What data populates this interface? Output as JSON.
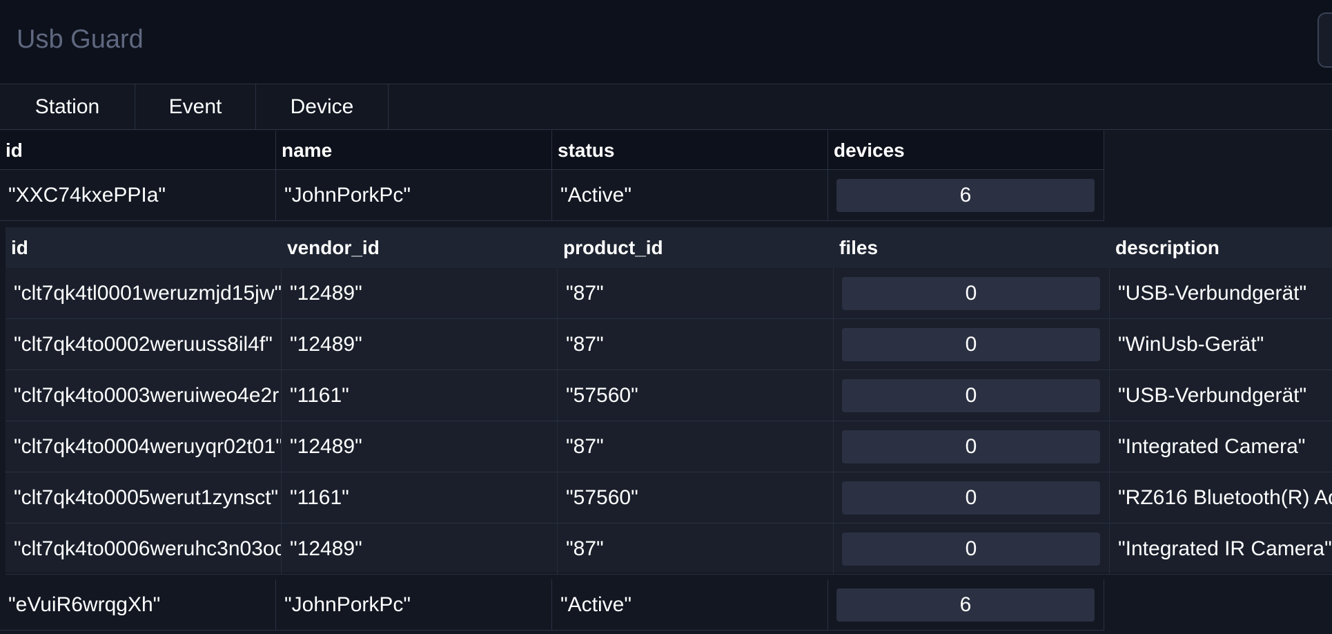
{
  "app": {
    "title": "Usb Guard"
  },
  "tabs": [
    {
      "label": "Station"
    },
    {
      "label": "Event"
    },
    {
      "label": "Device"
    }
  ],
  "stations": {
    "columns": [
      "id",
      "name",
      "status",
      "devices"
    ],
    "rows": [
      {
        "id": "\"XXC74kxePPIa\"",
        "name": "\"JohnPorkPc\"",
        "status": "\"Active\"",
        "devices": "6"
      },
      {
        "id": "\"eVuiR6wrqgXh\"",
        "name": "\"JohnPorkPc\"",
        "status": "\"Active\"",
        "devices": "6"
      }
    ]
  },
  "devices": {
    "columns": [
      "id",
      "vendor_id",
      "product_id",
      "files",
      "description"
    ],
    "rows": [
      {
        "id": "\"clt7qk4tl0001weruzmjd15jw\"",
        "vendor_id": "\"12489\"",
        "product_id": "\"87\"",
        "files": "0",
        "description": "\"USB-Verbundgerät\""
      },
      {
        "id": "\"clt7qk4to0002weruuss8il4f\"",
        "vendor_id": "\"12489\"",
        "product_id": "\"87\"",
        "files": "0",
        "description": "\"WinUsb-Gerät\""
      },
      {
        "id": "\"clt7qk4to0003weruiweo4e2r",
        "vendor_id": "\"1161\"",
        "product_id": "\"57560\"",
        "files": "0",
        "description": "\"USB-Verbundgerät\""
      },
      {
        "id": "\"clt7qk4to0004weruyqr02t01\"",
        "vendor_id": "\"12489\"",
        "product_id": "\"87\"",
        "files": "0",
        "description": "\"Integrated Camera\""
      },
      {
        "id": "\"clt7qk4to0005werut1zynsct\"",
        "vendor_id": "\"1161\"",
        "product_id": "\"57560\"",
        "files": "0",
        "description": "\"RZ616 Bluetooth(R) Ad"
      },
      {
        "id": "\"clt7qk4to0006weruhc3n03oc",
        "vendor_id": "\"12489\"",
        "product_id": "\"87\"",
        "files": "0",
        "description": "\"Integrated IR Camera\""
      }
    ]
  }
}
